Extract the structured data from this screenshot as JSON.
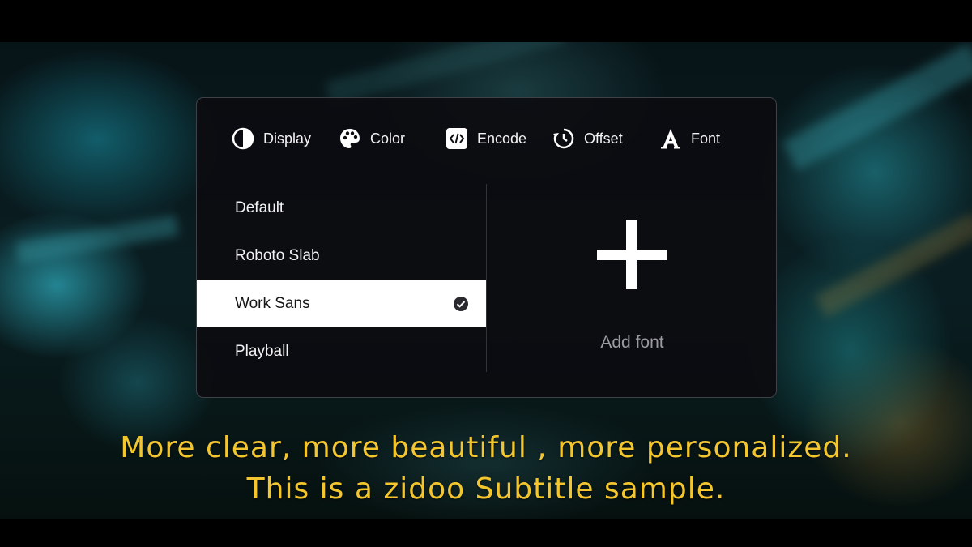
{
  "colors": {
    "panel_background": "#0c0c10",
    "selected_row": "#ffffff",
    "subtitle": "#f3c62f",
    "muted_text": "#9a9aa0"
  },
  "tabs": [
    {
      "label": "Display",
      "icon": "contrast-half-circle-icon"
    },
    {
      "label": "Color",
      "icon": "palette-icon"
    },
    {
      "label": "Encode",
      "icon": "code-brackets-icon"
    },
    {
      "label": "Offset",
      "icon": "timer-offset-icon"
    },
    {
      "label": "Font",
      "icon": "font-letter-a-icon"
    }
  ],
  "font_list": {
    "items": [
      {
        "label": "Default"
      },
      {
        "label": "Roboto Slab"
      },
      {
        "label": "Work Sans",
        "selected": true
      },
      {
        "label": "Playball"
      }
    ]
  },
  "add_font": {
    "icon": "plus-icon",
    "label": "Add font"
  },
  "subtitle": {
    "line1": "More clear, more beautiful , more personalized.",
    "line2": "This is a zidoo Subtitle sample."
  }
}
